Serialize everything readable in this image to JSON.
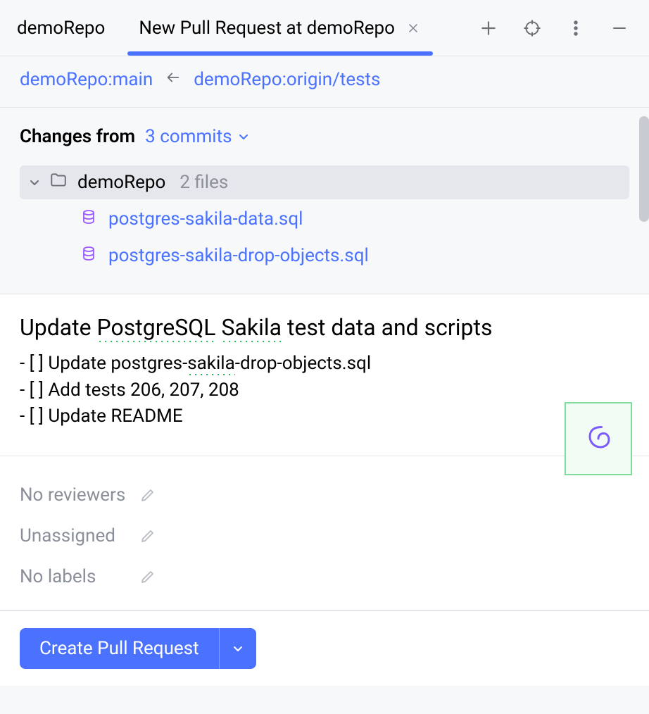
{
  "tabs": {
    "repoTab": "demoRepo",
    "prTab": "New Pull Request at demoRepo"
  },
  "branches": {
    "target": "demoRepo:main",
    "source": "demoRepo:origin/tests"
  },
  "changes": {
    "label": "Changes from",
    "commitCount": "3 commits",
    "repoName": "demoRepo",
    "fileCount": "2 files",
    "files": [
      "postgres-sakila-data.sql",
      "postgres-sakila-drop-objects.sql"
    ]
  },
  "pr": {
    "title_plain": "Update PostgreSQL Sakila test data and scripts",
    "checklist": [
      "Update postgres-sakila-drop-objects.sql",
      "Add tests 206, 207, 208",
      "Update README"
    ]
  },
  "meta": {
    "reviewers": "No reviewers",
    "assignee": "Unassigned",
    "labels": "No labels"
  },
  "footer": {
    "createLabel": "Create Pull Request"
  }
}
